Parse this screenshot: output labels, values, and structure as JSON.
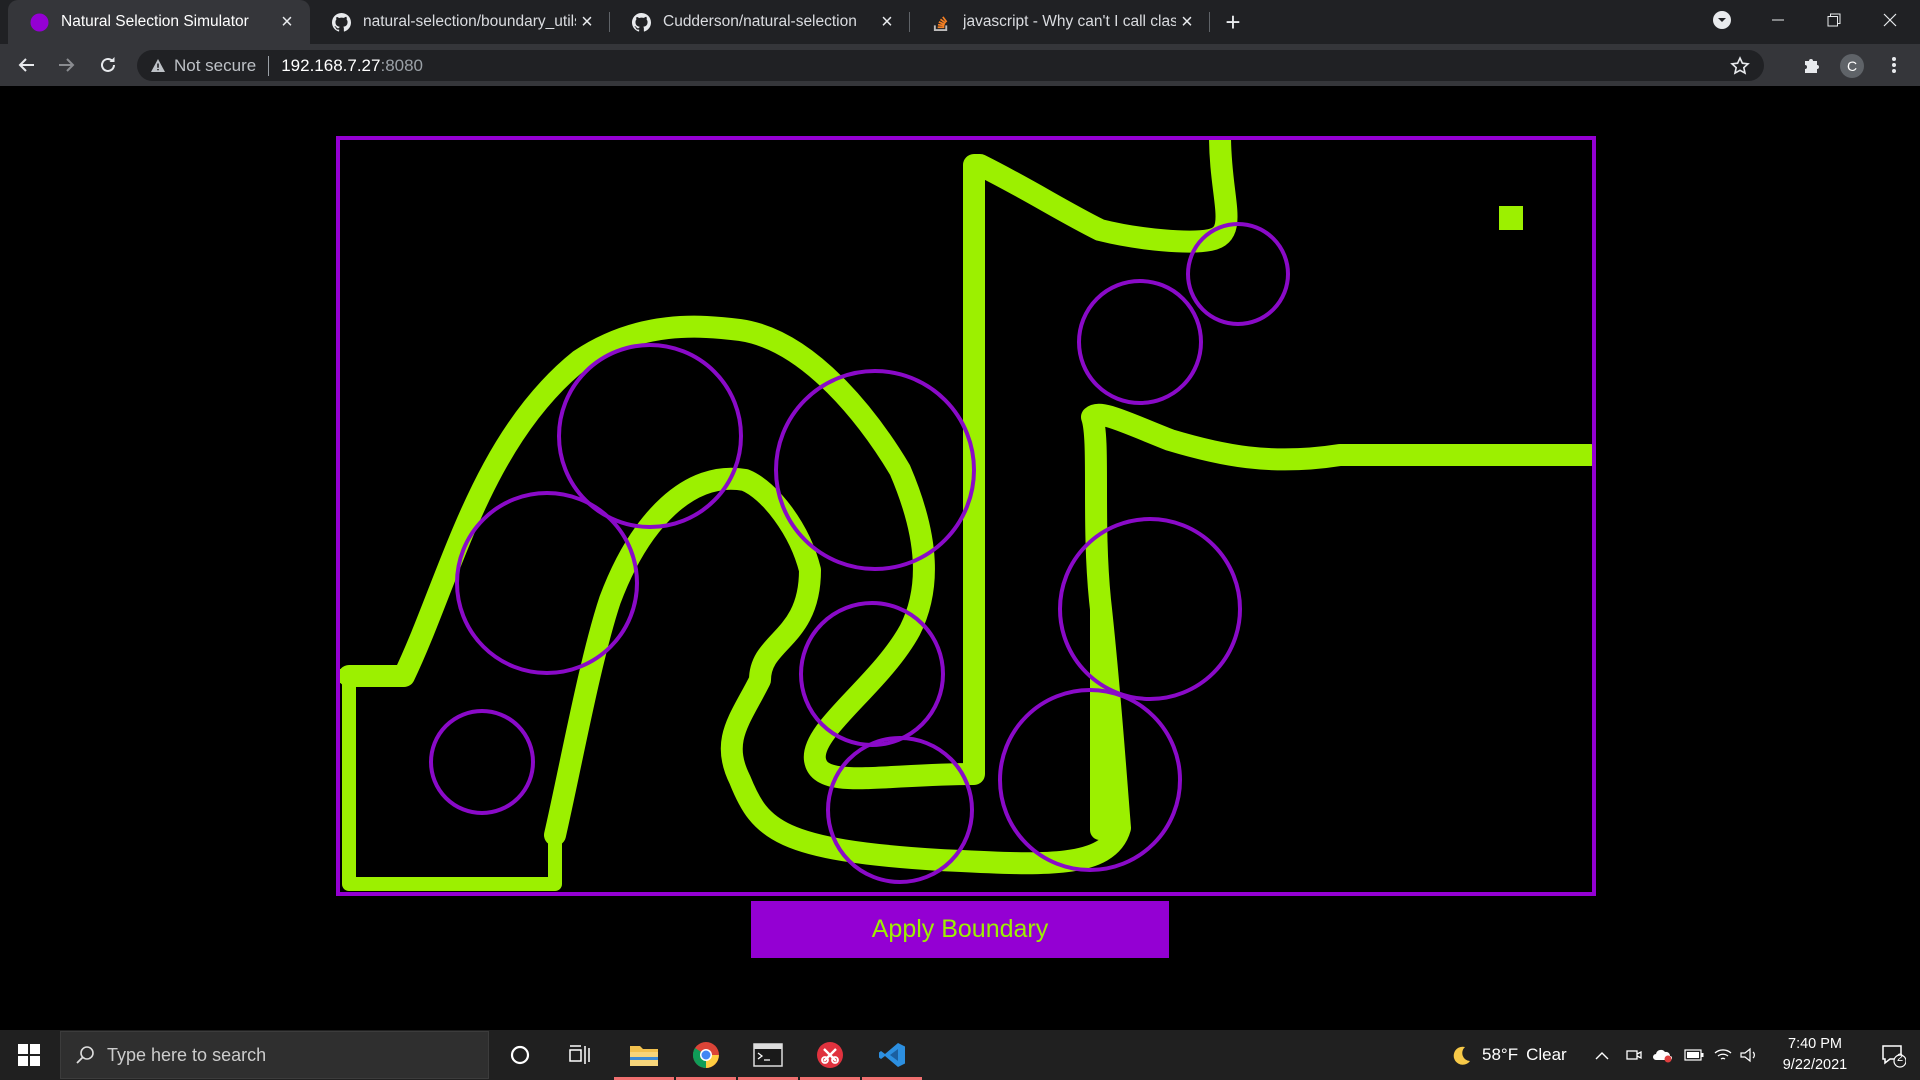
{
  "browser": {
    "tabs": [
      {
        "title": "Natural Selection Simulator",
        "icon": "purple-dot-icon",
        "active": true
      },
      {
        "title": "natural-selection/boundary_utils.",
        "icon": "github-icon",
        "active": false
      },
      {
        "title": "Cudderson/natural-selection",
        "icon": "github-icon",
        "active": false
      },
      {
        "title": "javascript - Why can't I call class f",
        "icon": "stackoverflow-icon",
        "active": false
      }
    ],
    "security_label": "Not secure",
    "url_host": "192.168.7.27",
    "url_port": ":8080",
    "profile_initial": "C"
  },
  "page": {
    "apply_button_label": "Apply Boundary",
    "colors": {
      "border": "#9400d3",
      "boundary_stroke": "#9cf000",
      "button_bg": "#9400d3",
      "button_text": "#9cf000"
    }
  },
  "taskbar": {
    "search_placeholder": "Type here to search",
    "weather_temp": "58°F",
    "weather_condition": "Clear",
    "time": "7:40 PM",
    "date": "9/22/2021",
    "notification_count": "2"
  }
}
